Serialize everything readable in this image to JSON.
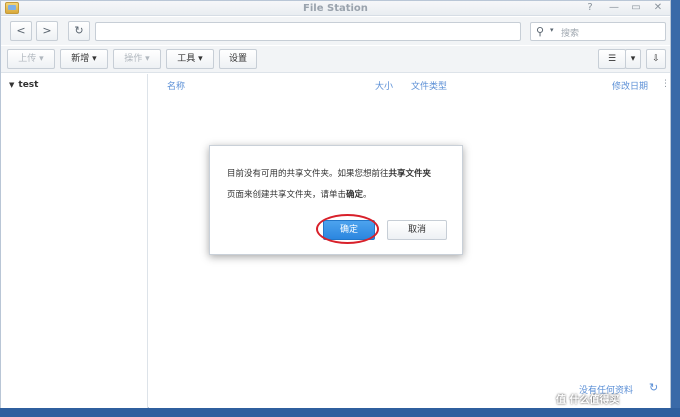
{
  "window": {
    "title": "File Station",
    "controls": [
      "?",
      "—",
      "▭",
      "✕"
    ]
  },
  "nav": {
    "back": "<",
    "forward": ">",
    "refresh": "↻"
  },
  "search": {
    "placeholder": "搜索"
  },
  "toolbar": {
    "upload": "上传 ▾",
    "create": "新增 ▾",
    "action": "操作 ▾",
    "tools": "工具 ▾",
    "settings": "设置",
    "view_list": "☰",
    "view_caret": "▾",
    "sort": "⇩"
  },
  "tree": {
    "root": "test"
  },
  "columns": {
    "name": "名称",
    "size": "大小",
    "type": "文件类型",
    "modified": "修改日期",
    "more": "⋮"
  },
  "status": {
    "empty": "没有任何资料"
  },
  "dialog": {
    "line1_prefix": "目前没有可用的共享文件夹。如果您想前往",
    "line1_bold": "共享文件夹",
    "line2_prefix": "页面来创建共享文件夹，请单击",
    "line2_bold": "确定",
    "line2_suffix": "。",
    "ok": "确定",
    "cancel": "取消"
  },
  "watermark": "值 什么值得买"
}
